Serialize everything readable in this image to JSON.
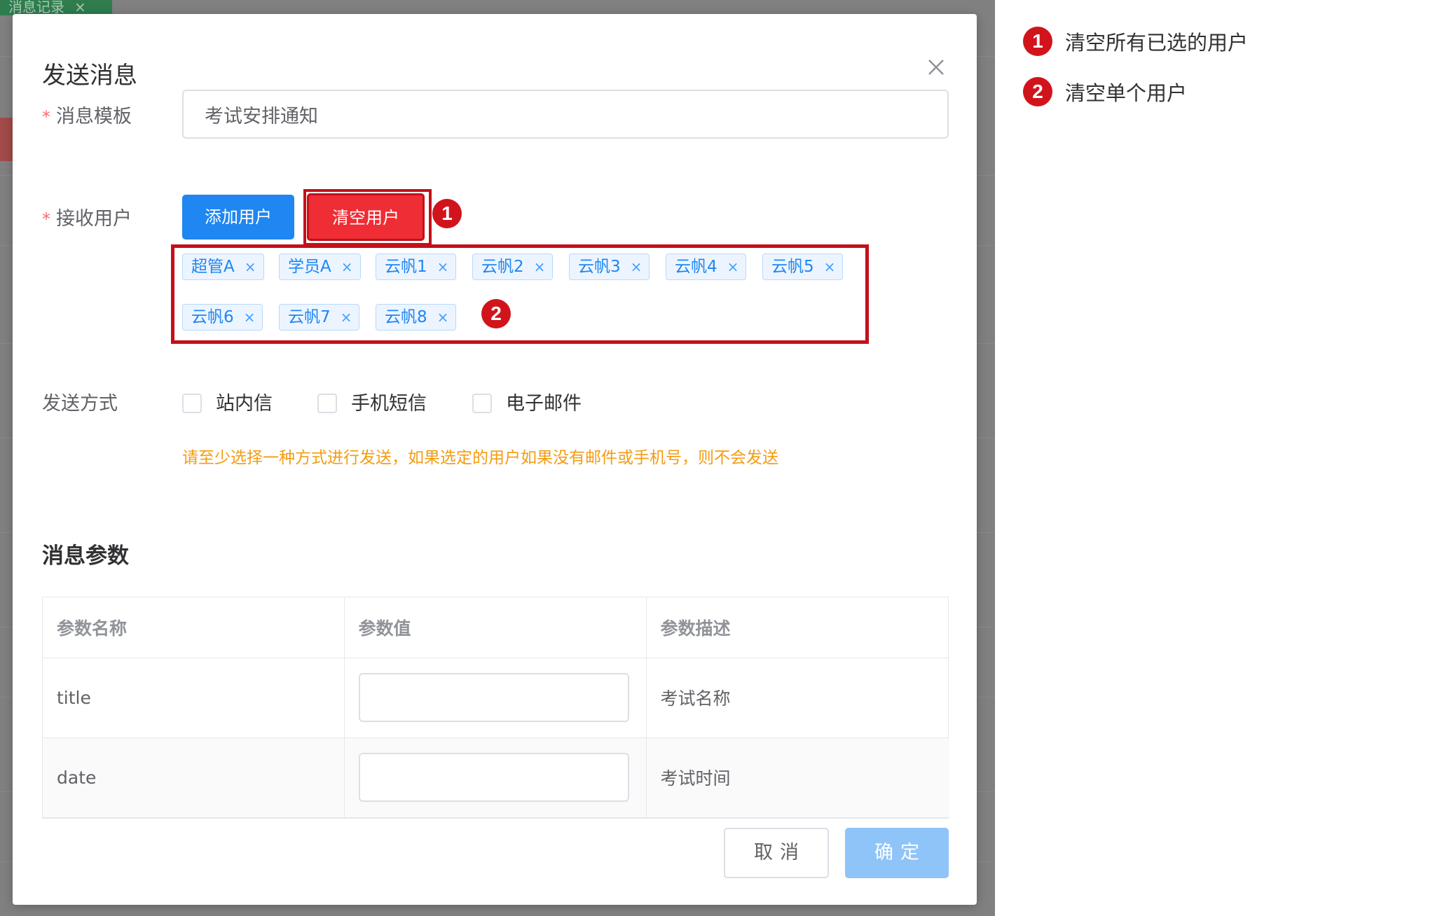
{
  "background": {
    "tab_label": "消息记录",
    "tab_close": "×"
  },
  "modal": {
    "title": "发送消息",
    "template_label": "消息模板",
    "template_value": "考试安排通知",
    "users_label": "接收用户",
    "required_mark": "*",
    "add_user_button": "添加用户",
    "clear_user_button": "清空用户",
    "tags": [
      "超管A",
      "学员A",
      "云帆1",
      "云帆2",
      "云帆3",
      "云帆4",
      "云帆5",
      "云帆6",
      "云帆7",
      "云帆8"
    ],
    "tag_close": "×",
    "send_method_label": "发送方式",
    "send_methods": [
      "站内信",
      "手机短信",
      "电子邮件"
    ],
    "hint": "请至少选择一种方式进行发送，如果选定的用户如果没有邮件或手机号，则不会发送",
    "params_title": "消息参数",
    "params_table": {
      "headers": [
        "参数名称",
        "参数值",
        "参数描述"
      ],
      "rows": [
        {
          "name": "title",
          "value": "",
          "desc": "考试名称"
        },
        {
          "name": "date",
          "value": "",
          "desc": "考试时间"
        }
      ]
    },
    "cancel_button": "取消",
    "ok_button": "确定"
  },
  "annotations": {
    "badge1": "1",
    "badge2": "2",
    "legend": [
      {
        "num": "1",
        "text": "清空所有已选的用户"
      },
      {
        "num": "2",
        "text": "清空单个用户"
      }
    ]
  },
  "colors": {
    "primary": "#1f86f2",
    "danger": "#ef2d34",
    "annotation_red": "#d1141c",
    "warning_text": "#f39c12"
  }
}
